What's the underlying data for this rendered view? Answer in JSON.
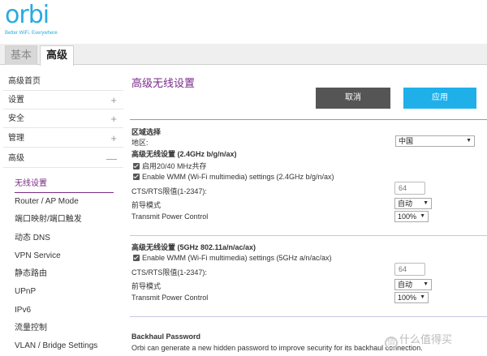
{
  "brand": {
    "logo": "orbi",
    "tagline": "Better WiFi. Everywhere"
  },
  "tabs": {
    "basic": "基本",
    "advanced": "高级"
  },
  "sidebar": {
    "items": [
      {
        "label": "高级首页",
        "toggle": ""
      },
      {
        "label": "设置",
        "toggle": "+"
      },
      {
        "label": "安全",
        "toggle": "+"
      },
      {
        "label": "管理",
        "toggle": "+"
      },
      {
        "label": "高级",
        "toggle": "—"
      }
    ],
    "subitems": [
      "无线设置",
      "Router / AP Mode",
      "端口映射/端口触发",
      "动态 DNS",
      "VPN Service",
      "静态路由",
      "UPnP",
      "IPv6",
      "流量控制",
      "VLAN / Bridge Settings"
    ]
  },
  "main": {
    "title": "高级无线设置",
    "cancel_label": "取消",
    "apply_label": "应用",
    "region": {
      "heading": "区域选择",
      "label": "地区:",
      "value": "中国"
    },
    "band24": {
      "heading": "高级无线设置 (2.4GHz b/g/n/ax)",
      "coexist_label": "启用20/40 MHz共存",
      "wmm_label": "Enable WMM (Wi-Fi multimedia) settings (2.4GHz b/g/n/ax)",
      "cts_label": "CTS/RTS限值(1-2347):",
      "cts_value": "64",
      "preamble_label": "前导模式",
      "preamble_value": "自动",
      "power_label": "Transmit Power Control",
      "power_value": "100%"
    },
    "band5": {
      "heading": "高级无线设置 (5GHz 802.11a/n/ac/ax)",
      "wmm_label": "Enable WMM (Wi-Fi multimedia) settings (5GHz a/n/ac/ax)",
      "cts_label": "CTS/RTS限值(1-2347):",
      "cts_value": "64",
      "preamble_label": "前导模式",
      "preamble_value": "自动",
      "power_label": "Transmit Power Control",
      "power_value": "100%"
    },
    "backhaul": {
      "heading": "Backhaul Password",
      "desc": "Orbi can generate a new hidden password to improve security for its backhaul connection."
    }
  },
  "watermark": {
    "text": "什么值得买",
    "icon": "值"
  },
  "colors": {
    "accent": "#7a2a8a",
    "brand": "#29a9e0",
    "apply": "#1fb0ea",
    "cancel": "#555555"
  }
}
